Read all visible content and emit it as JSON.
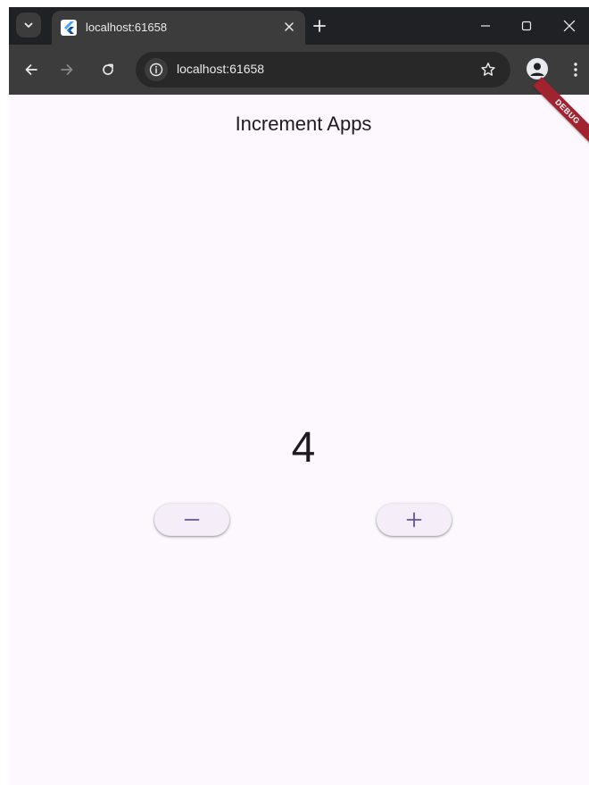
{
  "browser": {
    "tab": {
      "title": "localhost:61658"
    },
    "address_bar": {
      "url": "localhost:61658"
    }
  },
  "app": {
    "title": "Increment Apps",
    "counter_value": "4",
    "debug_banner": "DEBUG"
  },
  "colors": {
    "surface": "#fdf7fe",
    "primary": "#6750a4",
    "debug_banner": "#a22330",
    "browser_frame": "#202124",
    "toolbar": "#3c3c3c"
  }
}
